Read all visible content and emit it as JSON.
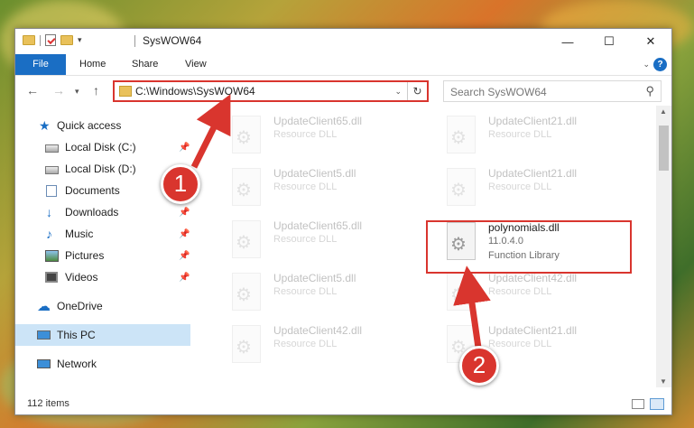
{
  "window": {
    "title": "SysWOW64",
    "controls": {
      "minimize": "—",
      "maximize": "☐",
      "close": "✕"
    }
  },
  "ribbon": {
    "tabs": [
      "File",
      "Home",
      "Share",
      "View"
    ],
    "help": "?"
  },
  "address_bar": {
    "path": "C:\\Windows\\SysWOW64",
    "search_placeholder": "Search SysWOW64"
  },
  "sidebar": {
    "items": [
      {
        "label": "Quick access",
        "icon": "star-icon",
        "pinned": false
      },
      {
        "label": "Local Disk (C:)",
        "icon": "drive-icon",
        "pinned": true
      },
      {
        "label": "Local Disk (D:)",
        "icon": "drive-icon",
        "pinned": false
      },
      {
        "label": "Documents",
        "icon": "documents-icon",
        "pinned": true
      },
      {
        "label": "Downloads",
        "icon": "download-icon",
        "pinned": true
      },
      {
        "label": "Music",
        "icon": "music-icon",
        "pinned": true
      },
      {
        "label": "Pictures",
        "icon": "pictures-icon",
        "pinned": true
      },
      {
        "label": "Videos",
        "icon": "videos-icon",
        "pinned": true
      },
      {
        "label": "OneDrive",
        "icon": "cloud-icon",
        "pinned": false
      },
      {
        "label": "This PC",
        "icon": "computer-icon",
        "pinned": false,
        "selected": true
      },
      {
        "label": "Network",
        "icon": "network-icon",
        "pinned": false
      }
    ]
  },
  "files": {
    "left": [
      {
        "name": "UpdateClient65.dll",
        "type": "Resource DLL"
      },
      {
        "name": "UpdateClient5.dll",
        "type": "Resource DLL"
      },
      {
        "name": "UpdateClient65.dll",
        "type": "Resource DLL"
      },
      {
        "name": "UpdateClient5.dll",
        "type": "Resource DLL"
      },
      {
        "name": "UpdateClient42.dll",
        "type": "Resource DLL"
      }
    ],
    "right": [
      {
        "name": "UpdateClient21.dll",
        "type": "Resource DLL"
      },
      {
        "name": "UpdateClient21.dll",
        "type": "Resource DLL"
      },
      {
        "name": "UpdateClient42.dll",
        "type": "Resource DLL"
      },
      {
        "name": "UpdateClient21.dll",
        "type": "Resource DLL"
      }
    ],
    "highlighted": {
      "name": "polynomials.dll",
      "version": "11.0.4.0",
      "type": "Function Library"
    }
  },
  "status": {
    "item_count": "112 items"
  },
  "annotations": {
    "step1": "1",
    "step2": "2",
    "color": "#d9352e"
  }
}
